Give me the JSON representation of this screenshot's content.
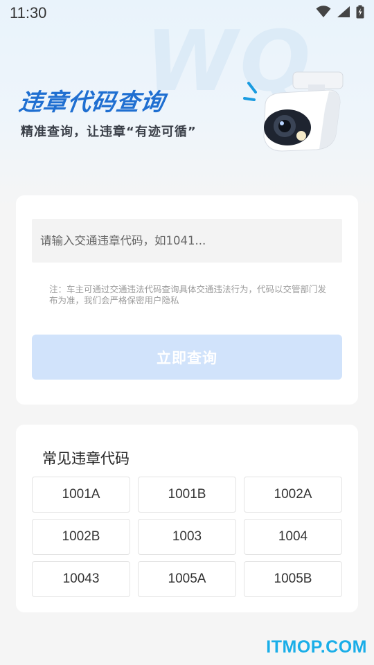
{
  "status_bar": {
    "time": "11:30",
    "icons": [
      "wifi-icon",
      "signal-icon",
      "battery-icon"
    ]
  },
  "header": {
    "watermark": "WQ",
    "title": "违章代码查询",
    "subtitle": "精准查询，让违章“有迹可循”",
    "illustration": "security-camera-icon"
  },
  "search": {
    "placeholder": "请输入交通违章代码，如1041...",
    "value": "",
    "note": "注：车主可通过交通违法代码查询具体交通违法行为，代码以交管部门发布为准，我们会严格保密用户隐私",
    "button_label": "立即查询"
  },
  "common_codes": {
    "title": "常见违章代码",
    "items": [
      "1001A",
      "1001B",
      "1002A",
      "1002B",
      "1003",
      "1004",
      "10043",
      "1005A",
      "1005B"
    ]
  },
  "watermark_footer": "ITMOP.COM",
  "colors": {
    "accent": "#1f6fd1",
    "button_disabled": "#d1e3fb",
    "footer_brand": "#1aaee8"
  }
}
